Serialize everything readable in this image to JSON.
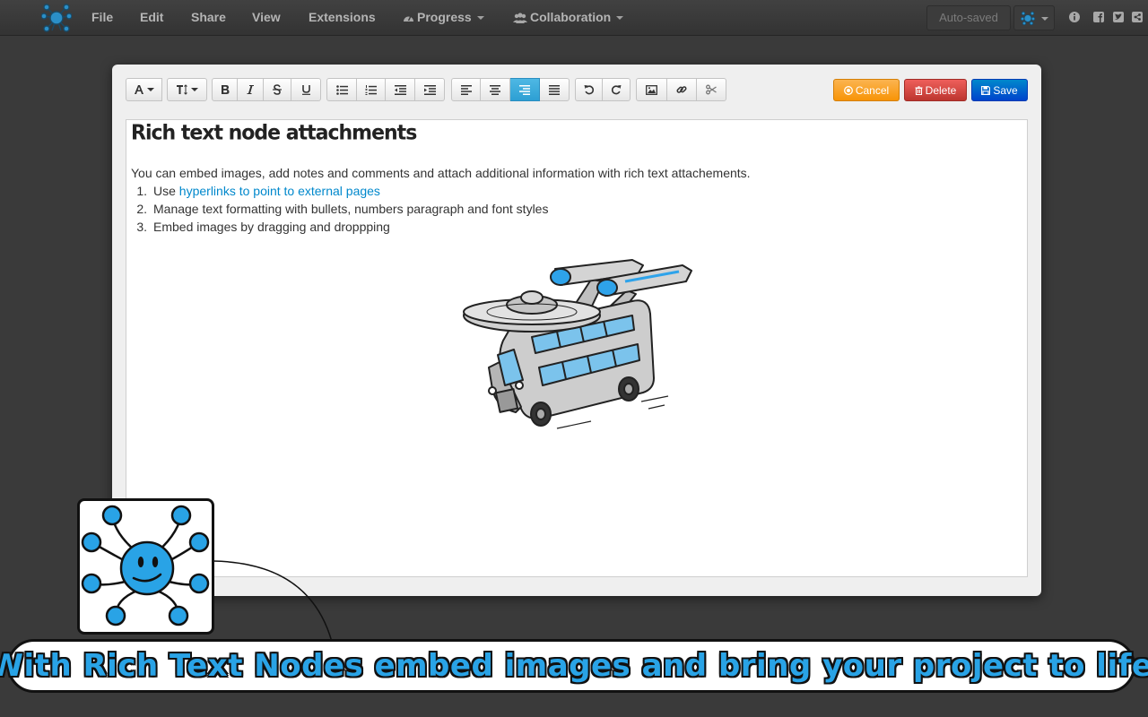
{
  "app": {
    "logo_icon": "octopus-logo-icon",
    "menu": [
      {
        "label": "File"
      },
      {
        "label": "Edit"
      },
      {
        "label": "Share"
      },
      {
        "label": "View"
      },
      {
        "label": "Extensions"
      },
      {
        "label": "Progress",
        "icon": "dashboard-icon"
      },
      {
        "label": "Collaboration",
        "icon": "users-icon"
      }
    ],
    "status": "Auto-saved",
    "right_icons": [
      "info-icon",
      "facebook-icon",
      "twitter-icon",
      "share-icon"
    ]
  },
  "toolbar": {
    "groups": [
      [
        "font-icon",
        "text-height-icon"
      ],
      [
        "bold-icon",
        "italic-icon",
        "strikethrough-icon",
        "underline-icon"
      ],
      [
        "bullet-list-icon",
        "numbered-list-icon",
        "outdent-icon",
        "indent-icon"
      ],
      [
        "align-left-icon",
        "align-center-icon",
        "align-right-icon",
        "align-justify-icon"
      ],
      [
        "undo-icon",
        "redo-icon"
      ],
      [
        "insert-image-icon",
        "link-icon",
        "cut-icon"
      ]
    ],
    "active": "align-right-icon",
    "cancel_label": "Cancel",
    "delete_label": "Delete",
    "save_label": "Save"
  },
  "document": {
    "title": "Rich text node attachments",
    "intro": "You can embed images, add notes and comments and attach additional information with rich text attachements.",
    "list": [
      {
        "num": "1.",
        "prefix": "Use ",
        "link": "hyperlinks to point to external pages",
        "text": ""
      },
      {
        "num": "2.",
        "prefix": "",
        "link": "",
        "text": "Manage text formatting with bullets, numbers paragraph and font styles"
      },
      {
        "num": "3.",
        "prefix": "",
        "link": "",
        "text": "Embed images by dragging and droppping"
      }
    ],
    "image_icon": "spaceship-bus-illustration"
  },
  "banner": {
    "text": "With Rich Text Nodes embed images and bring your project to life",
    "mascot_icon": "octopus-mascot-icon"
  },
  "colors": {
    "accent_blue": "#29a3e6",
    "cancel": "#f89406",
    "delete": "#bd362f",
    "save": "#0044cc",
    "link": "#0088cc"
  }
}
